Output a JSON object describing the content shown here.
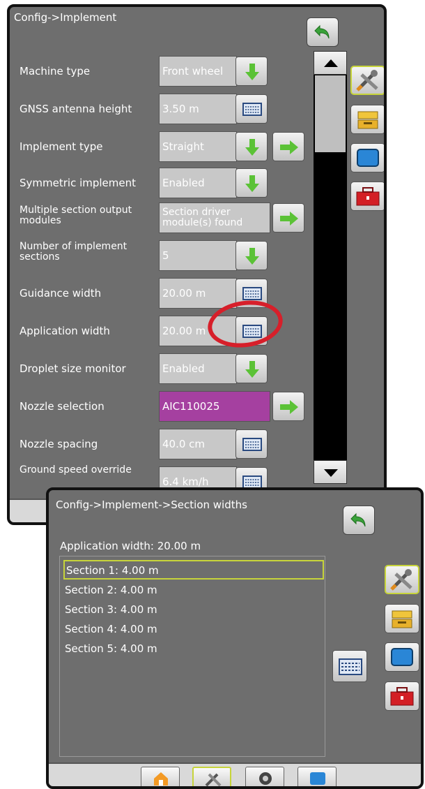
{
  "panel1": {
    "title": "Config->Implement",
    "rows": [
      {
        "label": "Machine type",
        "value": "Front wheel"
      },
      {
        "label": "GNSS antenna height",
        "value": "3.50 m"
      },
      {
        "label": "Implement type",
        "value": "Straight"
      },
      {
        "label": "Symmetric implement",
        "value": "Enabled"
      },
      {
        "label": "Multiple section output modules",
        "value": "Section driver module(s) found"
      },
      {
        "label": "Number of implement sections",
        "value": "5"
      },
      {
        "label": "Guidance width",
        "value": "20.00 m"
      },
      {
        "label": "Application width",
        "value": "20.00 m"
      },
      {
        "label": "Droplet size monitor",
        "value": "Enabled"
      },
      {
        "label": "Nozzle selection",
        "value": "AIC110025"
      },
      {
        "label": "Nozzle spacing",
        "value": "40.0 cm"
      },
      {
        "label": "Ground speed override",
        "value": "6.4 km/h"
      }
    ]
  },
  "panel2": {
    "title": "Config->Implement->Section widths",
    "application_width": "Application width: 20.00 m",
    "sections": [
      "Section 1: 4.00 m",
      "Section 2: 4.00 m",
      "Section 3: 4.00 m",
      "Section 4: 4.00 m",
      "Section 5: 4.00 m"
    ]
  },
  "colors": {
    "background": "#6e6e6e",
    "field_box": "#c8c8c8",
    "nozzle_highlight": "#a540a0",
    "selected_outline": "#c7d43a",
    "annotation_ring": "#d71f2a"
  },
  "icons": {
    "back": "return-arrow-icon",
    "dropdown": "green-down-arrow-icon",
    "next": "green-right-arrow-icon",
    "keyboard": "keyboard-icon",
    "tabs": [
      "tools-icon",
      "console-icon",
      "display-icon",
      "toolbox-icon"
    ],
    "bottom": [
      "home-icon",
      "tools-icon",
      "camera-icon",
      "screen-icon"
    ]
  }
}
